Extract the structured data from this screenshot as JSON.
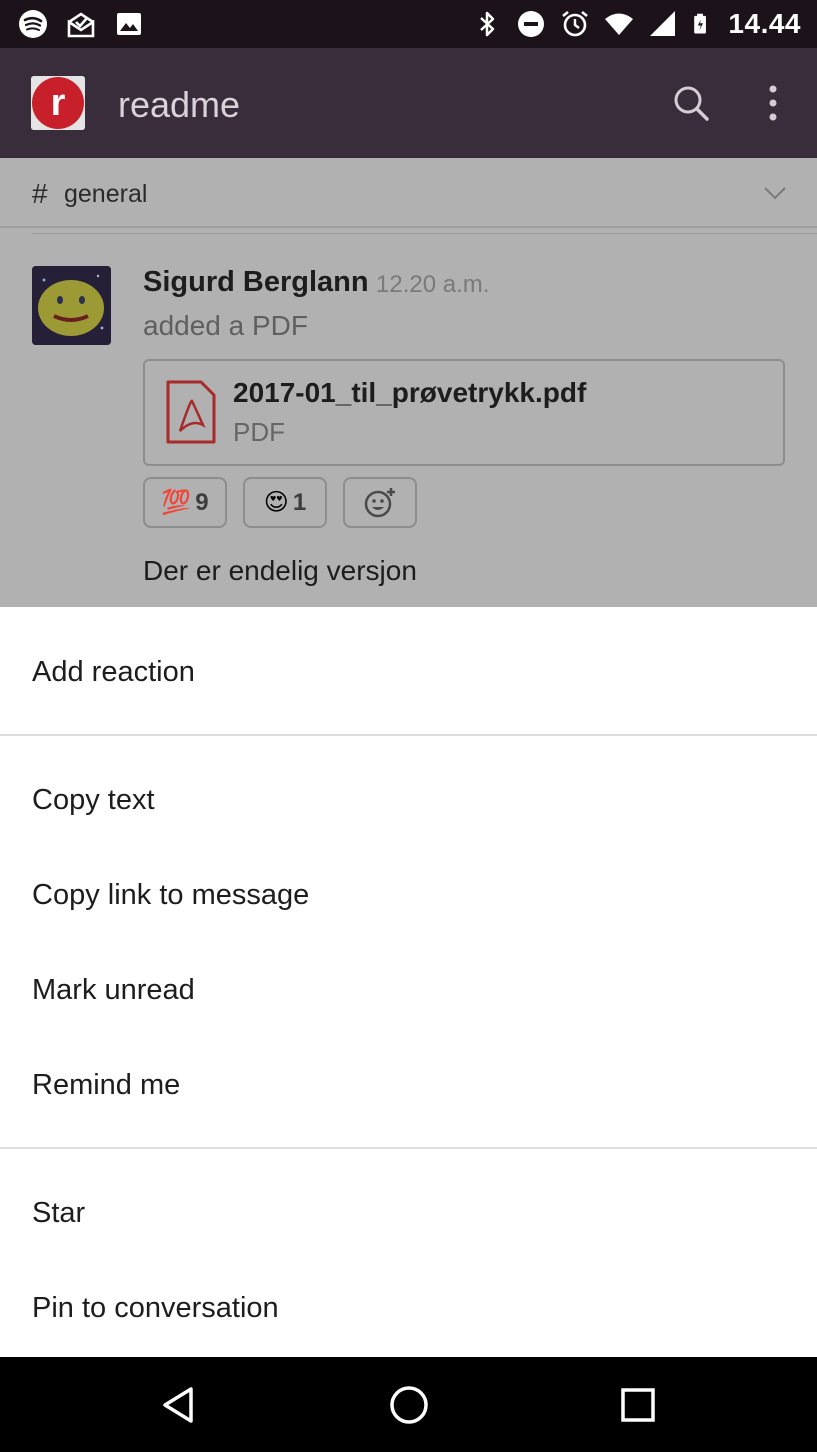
{
  "status_bar": {
    "time": "14.44",
    "left_icons": [
      "spotify-icon",
      "mail-check-icon",
      "image-icon"
    ],
    "right_icons": [
      "bluetooth-icon",
      "do-not-disturb-icon",
      "alarm-icon",
      "wifi-icon",
      "signal-icon",
      "battery-icon"
    ]
  },
  "app_bar": {
    "logo_letter": "r",
    "title": "readme",
    "brand_color": "#c8202a",
    "background_color": "#3a2d3b"
  },
  "channel": {
    "hash": "#",
    "name": "general"
  },
  "message": {
    "sender": "Sigurd Berglann",
    "time": "12.20 a.m.",
    "action": "added a PDF",
    "attachment": {
      "file_name": "2017-01_til_prøvetrykk.pdf",
      "file_type": "PDF"
    },
    "reactions": [
      {
        "emoji": "💯",
        "count": "9",
        "icon": "hundred-points-emoji"
      },
      {
        "emoji": "😍",
        "count": "1",
        "icon": "heart-eyes-emoji"
      }
    ],
    "add_reaction_icon": "add-reaction-icon",
    "text": "Der er endelig versjon"
  },
  "menu": {
    "groups": [
      [
        "Add reaction"
      ],
      [
        "Copy text",
        "Copy link to message",
        "Mark unread",
        "Remind me"
      ],
      [
        "Star",
        "Pin to conversation"
      ]
    ]
  },
  "nav_bar": {
    "icons": [
      "back-triangle-icon",
      "home-circle-icon",
      "recents-square-icon"
    ]
  }
}
